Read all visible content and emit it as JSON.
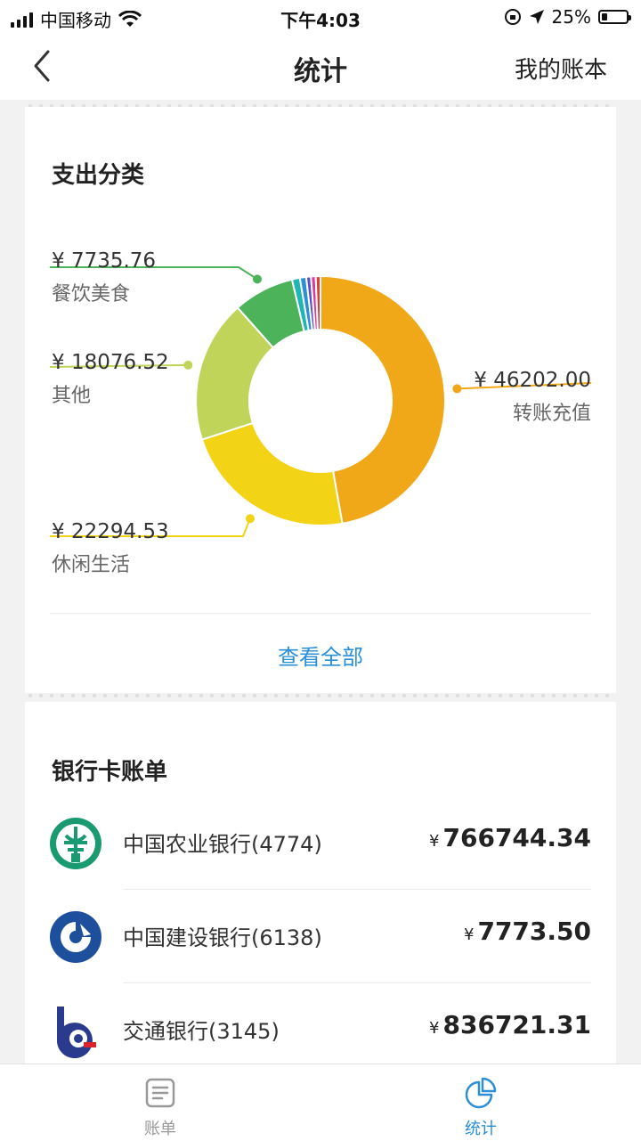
{
  "status_bar": {
    "carrier": "中国移动",
    "time": "下午4:03",
    "battery": "25%"
  },
  "nav": {
    "title": "统计",
    "right_label": "我的账本"
  },
  "expense": {
    "title": "支出分类",
    "view_all": "查看全部",
    "categories": [
      {
        "name": "转账充值",
        "amount": "¥ 46202.00",
        "color": "#f0a818"
      },
      {
        "name": "休闲生活",
        "amount": "¥ 22294.53",
        "color": "#f2d316"
      },
      {
        "name": "其他",
        "amount": "¥ 18076.52",
        "color": "#c1d45a"
      },
      {
        "name": "餐饮美食",
        "amount": "¥ 7735.76",
        "color": "#4cb35a"
      }
    ]
  },
  "chart_data": {
    "type": "pie",
    "categories": [
      "转账充值",
      "休闲生活",
      "其他",
      "餐饮美食",
      "",
      "",
      "",
      "",
      ""
    ],
    "values": [
      46202.0,
      22294.53,
      18076.52,
      7735.76,
      1000,
      800,
      600,
      600,
      600
    ],
    "colors": [
      "#f0a818",
      "#f2d316",
      "#c1d45a",
      "#4cb35a",
      "#1fb5b5",
      "#2a8fd6",
      "#5a4fc8",
      "#d63c9a",
      "#e23b3b"
    ]
  },
  "banks": {
    "title": "银行卡账单",
    "items": [
      {
        "name": "中国农业银行(4774)",
        "yen": "¥",
        "amount": "766744.34"
      },
      {
        "name": "中国建设银行(6138)",
        "yen": "¥",
        "amount": "7773.50"
      },
      {
        "name": "交通银行(3145)",
        "yen": "¥",
        "amount": "836721.31"
      }
    ]
  },
  "tabbar": {
    "bills": "账单",
    "stats": "统计",
    "active_color": "#2a8fd6",
    "inactive_color": "#999999"
  }
}
